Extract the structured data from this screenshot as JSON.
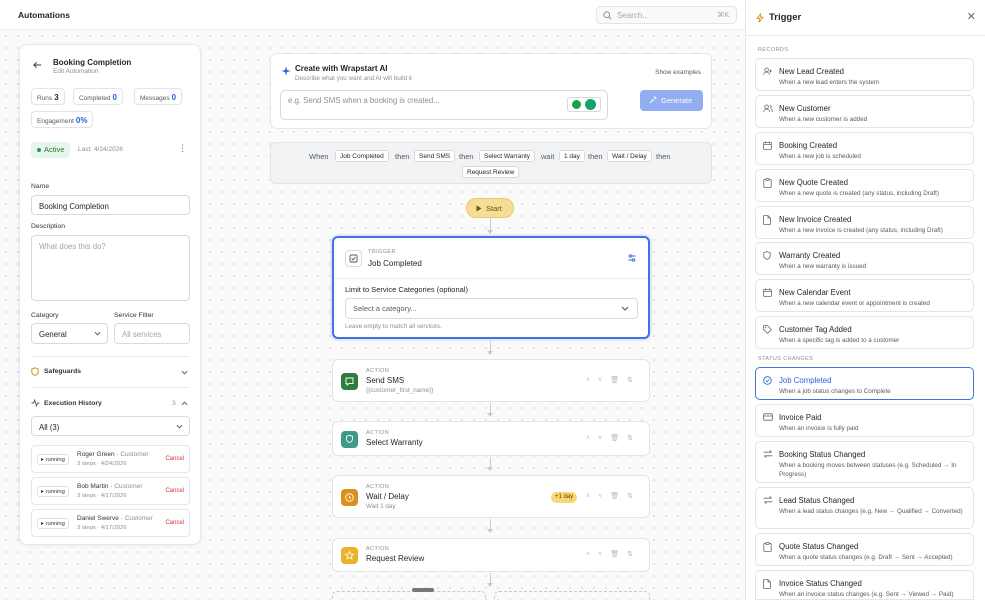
{
  "topbar": {
    "title": "Automations",
    "search_placeholder": "Search...",
    "shortcut": "⌘K"
  },
  "left": {
    "title": "Booking Completion",
    "subtitle": "Edit Automation",
    "stats": {
      "runs_label": "Runs",
      "runs": "3",
      "completed_label": "Completed",
      "completed": "0",
      "messages_label": "Messages",
      "messages": "0",
      "engagement_label": "Engagement",
      "engagement": "0%"
    },
    "status": "Active",
    "last": "Last: 4/24/2026",
    "name_label": "Name",
    "name_value": "Booking Completion",
    "description_label": "Description",
    "description_placeholder": "What does this do?",
    "category_label": "Category",
    "category_value": "General",
    "service_filter_label": "Service Filter",
    "service_filter_placeholder": "All services",
    "safeguards_label": "Safeguards",
    "history_label": "Execution History",
    "history_count": "3",
    "history_filter": "All (3)",
    "history": [
      {
        "status": "running",
        "name": "Roger Green",
        "type": "Customer",
        "meta": "3 steps · 4/24/2026",
        "action": "Cancel"
      },
      {
        "status": "running",
        "name": "Bob Martin",
        "type": "Customer",
        "meta": "3 steps · 4/17/2026",
        "action": "Cancel"
      },
      {
        "status": "running",
        "name": "Daniel Swerve",
        "type": "Customer",
        "meta": "3 steps · 4/17/2026",
        "action": "Cancel"
      }
    ]
  },
  "ai": {
    "title": "Create with Wrapstart AI",
    "subtitle": "Describe what you want and AI will build it",
    "examples": "Show examples",
    "placeholder": "e.g. Send SMS when a booking is created...",
    "generate": "Generate"
  },
  "sentence": {
    "when": "When",
    "c1": "Job Completed",
    "then1": "then",
    "c2": "Send SMS",
    "then2": "then",
    "c3": "Select Warranty",
    "wait": "wait",
    "c4": "1 day",
    "then3": "then",
    "c5": "Wait / Delay",
    "then4": "then",
    "c6": "Request Review"
  },
  "flow": {
    "start": "Start",
    "trigger": {
      "label": "TRIGGER",
      "name": "Job Completed",
      "limit_label": "Limit to Service Categories (optional)",
      "select_placeholder": "Select a category...",
      "hint": "Leave empty to match all services."
    },
    "actions": [
      {
        "label": "ACTION",
        "name": "Send SMS",
        "sub": "{{customer_first_name}}",
        "color": "#2f7d3c"
      },
      {
        "label": "ACTION",
        "name": "Select Warranty",
        "sub": "",
        "color": "#3d9a86"
      },
      {
        "label": "ACTION",
        "name": "Wait / Delay",
        "sub": "Wait 1 day",
        "pill": "+1 day",
        "color": "#d9901c"
      },
      {
        "label": "ACTION",
        "name": "Request Review",
        "sub": "",
        "color": "#e8b52a"
      }
    ]
  },
  "panel": {
    "title": "Trigger",
    "records_label": "RECORDS",
    "status_label": "STATUS CHANGES",
    "records": [
      {
        "title": "New Lead Created",
        "desc": "When a new lead enters the system",
        "icon": "user-plus-icon"
      },
      {
        "title": "New Customer",
        "desc": "When a new customer is added",
        "icon": "users-icon"
      },
      {
        "title": "Booking Created",
        "desc": "When a new job is scheduled",
        "icon": "calendar-icon"
      },
      {
        "title": "New Quote Created",
        "desc": "When a new quote is created (any status, including Draft)",
        "icon": "clipboard-icon"
      },
      {
        "title": "New Invoice Created",
        "desc": "When a new invoice is created (any status, including Draft)",
        "icon": "file-icon"
      },
      {
        "title": "Warranty Created",
        "desc": "When a new warranty is issued",
        "icon": "shield-icon"
      },
      {
        "title": "New Calendar Event",
        "desc": "When a new calendar event or appointment is created",
        "icon": "calendar-icon"
      },
      {
        "title": "Customer Tag Added",
        "desc": "When a specific tag is added to a customer",
        "icon": "tag-icon"
      }
    ],
    "statuses": [
      {
        "title": "Job Completed",
        "desc": "When a job status changes to Complete",
        "icon": "check-circle-icon"
      },
      {
        "title": "Invoice Paid",
        "desc": "When an invoice is fully paid",
        "icon": "card-icon"
      },
      {
        "title": "Booking Status Changed",
        "desc": "When a booking moves between statuses (e.g. Scheduled → In Progress)",
        "icon": "swap-icon"
      },
      {
        "title": "Lead Status Changed",
        "desc": "When a lead status changes (e.g. New → Qualified → Converted)",
        "icon": "swap-icon"
      },
      {
        "title": "Quote Status Changed",
        "desc": "When a quote status changes (e.g. Draft → Sent → Accepted)",
        "icon": "clipboard-icon"
      },
      {
        "title": "Invoice Status Changed",
        "desc": "When an invoice status changes (e.g. Sent → Viewed → Paid)",
        "icon": "file-icon"
      }
    ]
  }
}
